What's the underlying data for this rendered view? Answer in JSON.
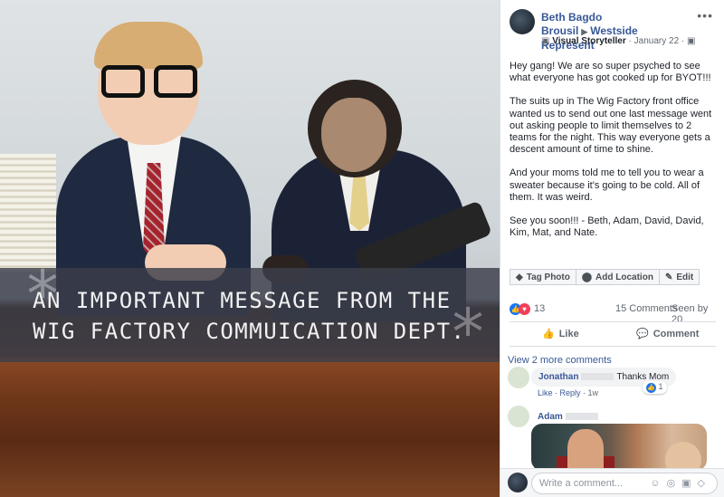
{
  "photo": {
    "caption_line1": "AN IMPORTANT MESSAGE FROM THE",
    "caption_line2": "WIG FACTORY COMMUICATION DEPT."
  },
  "post": {
    "author": "Beth Bagdo Brousil",
    "group": "Westside Represent",
    "badge": "Visual Storyteller",
    "date": "January 22",
    "paragraphs": [
      "Hey gang! We are so super psyched to see what everyone has got cooked up for BYOT!!!",
      "The suits up in The Wig Factory front office wanted us to send out one last message went out asking people to limit themselves to 2 teams for the night. This way everyone gets a descent amount of time to shine.",
      "And your moms told me to tell you to wear a sweater because it's going to be cold. All of them. It was weird.",
      "See you soon!!! - Beth, Adam, David, David, Kim, Mat, and Nate."
    ]
  },
  "tags": {
    "tag_photo": "Tag Photo",
    "add_location": "Add Location",
    "edit": "Edit"
  },
  "reactions": {
    "count": "13",
    "comments": "15 Comments",
    "seen": "Seen by 20"
  },
  "actions": {
    "like": "Like",
    "comment": "Comment"
  },
  "comments": {
    "view_more": "View 2 more comments",
    "items": [
      {
        "name": "Jonathan",
        "text": "Thanks Mom",
        "like": "Like",
        "reply": "Reply",
        "time": "1w",
        "reactions": "1"
      },
      {
        "name": "Adam"
      }
    ]
  },
  "composer": {
    "placeholder": "Write a comment..."
  }
}
